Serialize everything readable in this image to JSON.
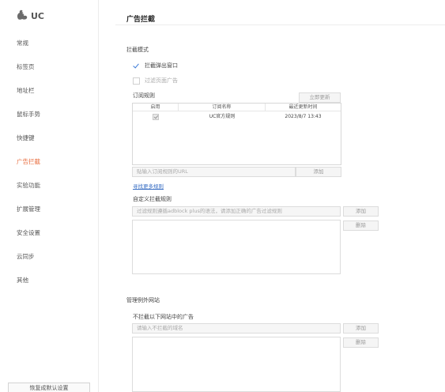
{
  "app": {
    "logo_text": "UC"
  },
  "sidebar": {
    "items": [
      {
        "label": "常规"
      },
      {
        "label": "标签页"
      },
      {
        "label": "地址栏"
      },
      {
        "label": "鼠标手势"
      },
      {
        "label": "快捷键"
      },
      {
        "label": "广告拦截"
      },
      {
        "label": "实验功能"
      },
      {
        "label": "扩展管理"
      },
      {
        "label": "安全设置"
      },
      {
        "label": "云同步"
      },
      {
        "label": "其他"
      }
    ],
    "active_index": 5,
    "reset_label": "恢复成默认设置"
  },
  "main": {
    "title": "广告拦截",
    "mode": {
      "label": "拦截模式",
      "block_popups": {
        "label": "拦截弹出窗口",
        "checked": true
      },
      "filter_ads": {
        "label": "过滤页面广告",
        "checked": false
      }
    },
    "subscriptions": {
      "label": "订阅规则",
      "update_button": "立即更新",
      "columns": {
        "enabled": "启用",
        "name": "订阅名称",
        "updated": "最近更新时间"
      },
      "rows": [
        {
          "enabled": true,
          "name": "UC官方规则",
          "updated": "2023/8/7 13:43"
        }
      ],
      "url_placeholder": "贴输入订阅规则的URL",
      "add_button": "添加",
      "more_link": "寻找更多规则"
    },
    "custom": {
      "label": "自定义拦截规则",
      "input_placeholder": "过滤规则遵循adblock plus的语法，请添加正确的广告过滤规则",
      "add_button": "添加",
      "delete_button": "删除"
    },
    "whitelist": {
      "label": "管理例外网站",
      "sublabel": "不拦截以下网站中的广告",
      "input_placeholder": "请输入不拦截的域名",
      "add_button": "添加",
      "delete_button": "删除"
    }
  },
  "colors": {
    "accent": "#e86a3a",
    "check": "#3a7ad8",
    "link": "#3a6fc4"
  },
  "icons": {
    "logo": "uc-squirrel-icon"
  }
}
